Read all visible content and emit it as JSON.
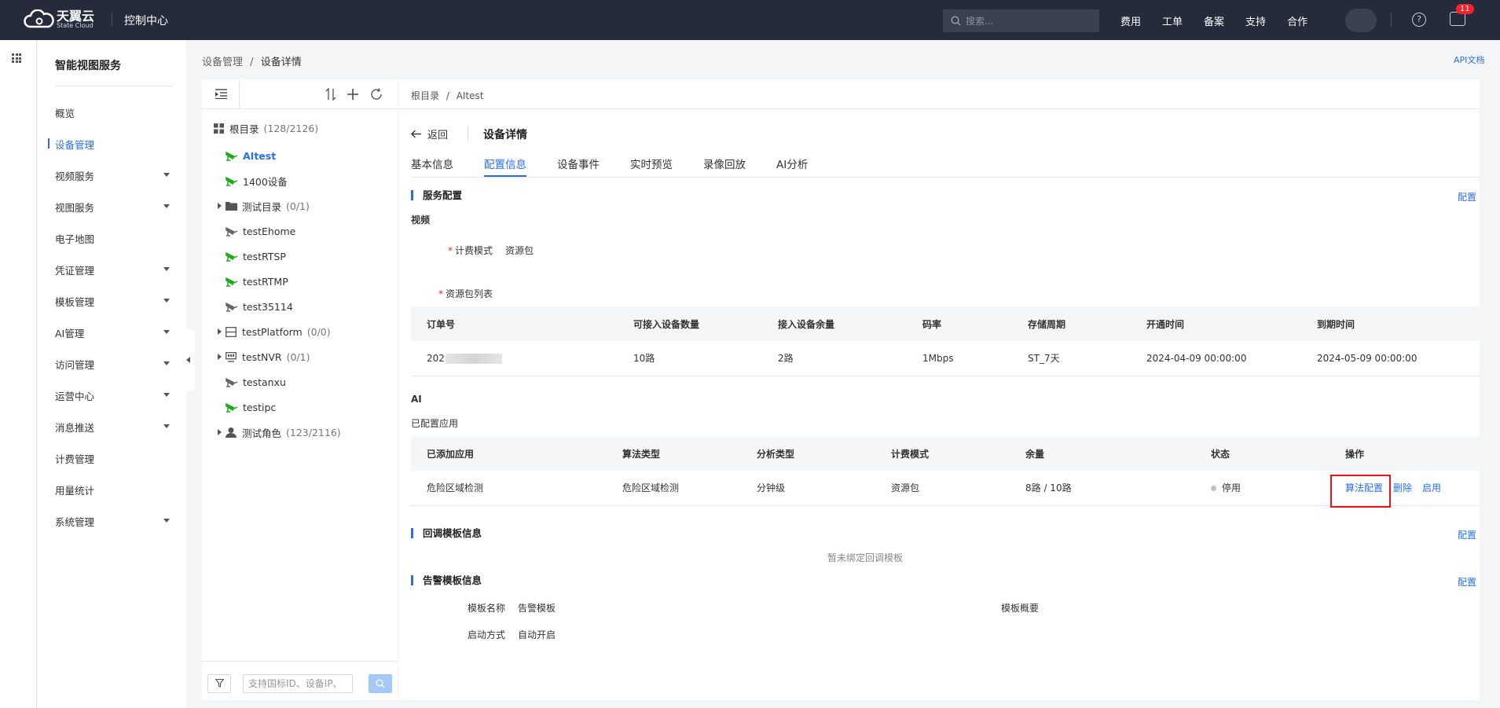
{
  "topbar": {
    "brand_cn": "天翼云",
    "brand_en": "State Cloud",
    "console": "控制中心",
    "search_placeholder": "搜索...",
    "nav": [
      "费用",
      "工单",
      "备案",
      "支持",
      "合作"
    ],
    "notification_count": "11"
  },
  "sidebar": {
    "title": "智能视图服务",
    "items": [
      {
        "label": "概览",
        "dropdown": false
      },
      {
        "label": "设备管理",
        "dropdown": false,
        "active": true
      },
      {
        "label": "视频服务",
        "dropdown": true
      },
      {
        "label": "视图服务",
        "dropdown": true
      },
      {
        "label": "电子地图",
        "dropdown": false
      },
      {
        "label": "凭证管理",
        "dropdown": true
      },
      {
        "label": "模板管理",
        "dropdown": true
      },
      {
        "label": "AI管理",
        "dropdown": true
      },
      {
        "label": "访问管理",
        "dropdown": true
      },
      {
        "label": "运营中心",
        "dropdown": true
      },
      {
        "label": "消息推送",
        "dropdown": true
      },
      {
        "label": "计费管理",
        "dropdown": false
      },
      {
        "label": "用量统计",
        "dropdown": false
      },
      {
        "label": "系统管理",
        "dropdown": true
      }
    ]
  },
  "breadcrumb": {
    "parent": "设备管理",
    "sep": "/",
    "current": "设备详情"
  },
  "api_doc": "API文档",
  "tree": {
    "root_label": "根目录",
    "root_count": "(128/2126)",
    "nodes": [
      {
        "label": "AItest",
        "icon": "camera-online-icon",
        "selected": true
      },
      {
        "label": "1400设备",
        "icon": "camera-online-icon"
      },
      {
        "label": "测试目录",
        "count": "(0/1)",
        "icon": "folder-icon",
        "expandable": true
      },
      {
        "label": "testEhome",
        "icon": "camera-offline-icon"
      },
      {
        "label": "testRTSP",
        "icon": "camera-online-icon"
      },
      {
        "label": "testRTMP",
        "icon": "camera-online-icon"
      },
      {
        "label": "test35114",
        "icon": "camera-offline-icon"
      },
      {
        "label": "testPlatform",
        "count": "(0/0)",
        "icon": "platform-icon",
        "expandable": true
      },
      {
        "label": "testNVR",
        "count": "(0/1)",
        "icon": "nvr-icon",
        "expandable": true
      },
      {
        "label": "testanxu",
        "icon": "camera-offline-icon"
      },
      {
        "label": "testipc",
        "icon": "camera-online-icon"
      },
      {
        "label": "测试角色",
        "count": "(123/2116)",
        "icon": "role-icon",
        "expandable": true
      }
    ],
    "search_placeholder": "支持国标ID、设备IP、"
  },
  "detail": {
    "path_root": "根目录",
    "path_sep": "/",
    "path_device": "AItest",
    "back": "返回",
    "title": "设备详情",
    "tabs": [
      "基本信息",
      "配置信息",
      "设备事件",
      "实时预览",
      "录像回放",
      "AI分析"
    ],
    "active_tab": "配置信息",
    "service_config": {
      "title": "服务配置",
      "config_link": "配置",
      "video_label": "视频",
      "billing_mode_label": "计费模式",
      "billing_mode_value": "资源包",
      "package_list_label": "资源包列表",
      "table": {
        "headers": [
          "订单号",
          "可接入设备数量",
          "接入设备余量",
          "码率",
          "存储周期",
          "开通时间",
          "到期时间"
        ],
        "rows": [
          {
            "order": "202",
            "capacity": "10路",
            "remaining": "2路",
            "bitrate": "1Mbps",
            "storage": "ST_7天",
            "start": "2024-04-09 00:00:00",
            "end": "2024-05-09 00:00:00"
          }
        ]
      },
      "ai_label": "AI",
      "configured_apps_label": "已配置应用",
      "ai_table": {
        "headers": [
          "已添加应用",
          "算法类型",
          "分析类型",
          "计费模式",
          "余量",
          "状态",
          "操作"
        ],
        "rows": [
          {
            "app": "危险区域检测",
            "algo": "危险区域检测",
            "analysis": "分钟级",
            "billing": "资源包",
            "remaining": "8路 / 10路",
            "status": "停用",
            "ops": [
              "算法配置",
              "删除",
              "启用"
            ]
          }
        ]
      }
    },
    "callback": {
      "title": "回调模板信息",
      "config_link": "配置",
      "empty": "暂未绑定回调模板"
    },
    "alarm": {
      "title": "告警模板信息",
      "config_link": "配置",
      "name_label": "模板名称",
      "name_value": "告警模板",
      "summary_label": "模板概要",
      "start_label": "启动方式",
      "start_value": "自动开启"
    }
  }
}
